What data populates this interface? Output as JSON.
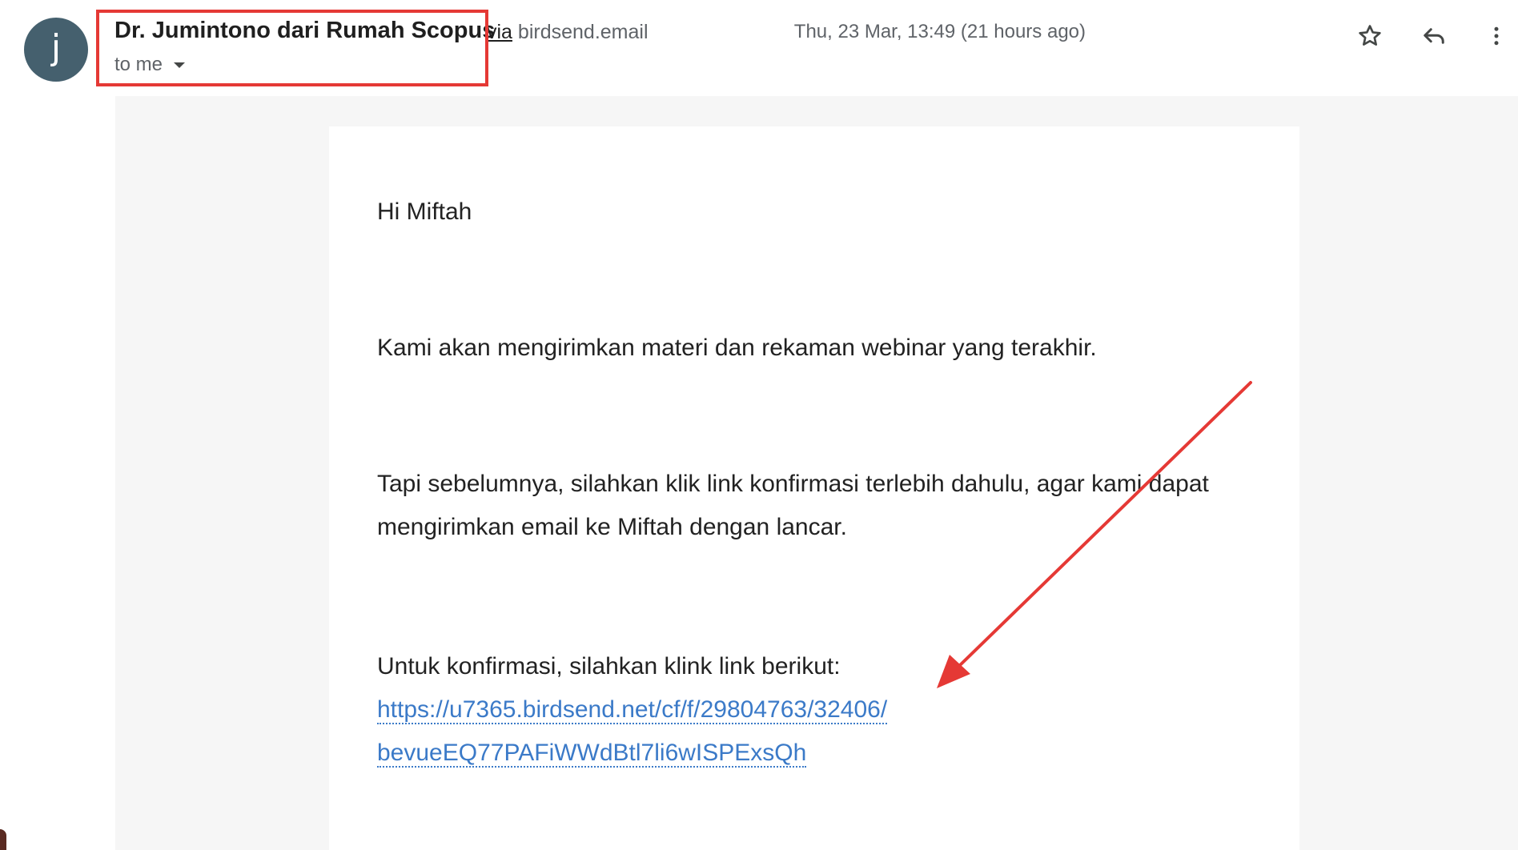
{
  "header": {
    "avatar_letter": "j",
    "sender_name": "Dr. Jumintono dari Rumah Scopus",
    "via_word": "via",
    "via_domain": "birdsend.email",
    "recipient": "to me",
    "timestamp": "Thu, 23 Mar, 13:49 (21 hours ago)",
    "icons": {
      "star": "star-icon",
      "reply": "reply-icon",
      "more": "more-vert-icon"
    }
  },
  "message": {
    "greeting": "Hi Miftah",
    "paragraph1": "Kami akan mengirimkan materi dan rekaman webinar yang terakhir.",
    "paragraph2": "Tapi sebelumnya, silahkan klik link konfirmasi terlebih dahulu, agar kami dapat mengirimkan email ke Miftah dengan lancar.",
    "paragraph3": "Untuk konfirmasi, silahkan klink link berikut:",
    "link_line1": "https://u7365.birdsend.net/cf/f/29804763/32406/",
    "link_line2": "bevueEQ77PAFiWWdBtl7li6wISPExsQh"
  },
  "colors": {
    "avatar_bg": "#45606e",
    "annotation_red": "#e53935",
    "link_blue": "#3b7ac8",
    "body_bg": "#f6f6f6"
  }
}
